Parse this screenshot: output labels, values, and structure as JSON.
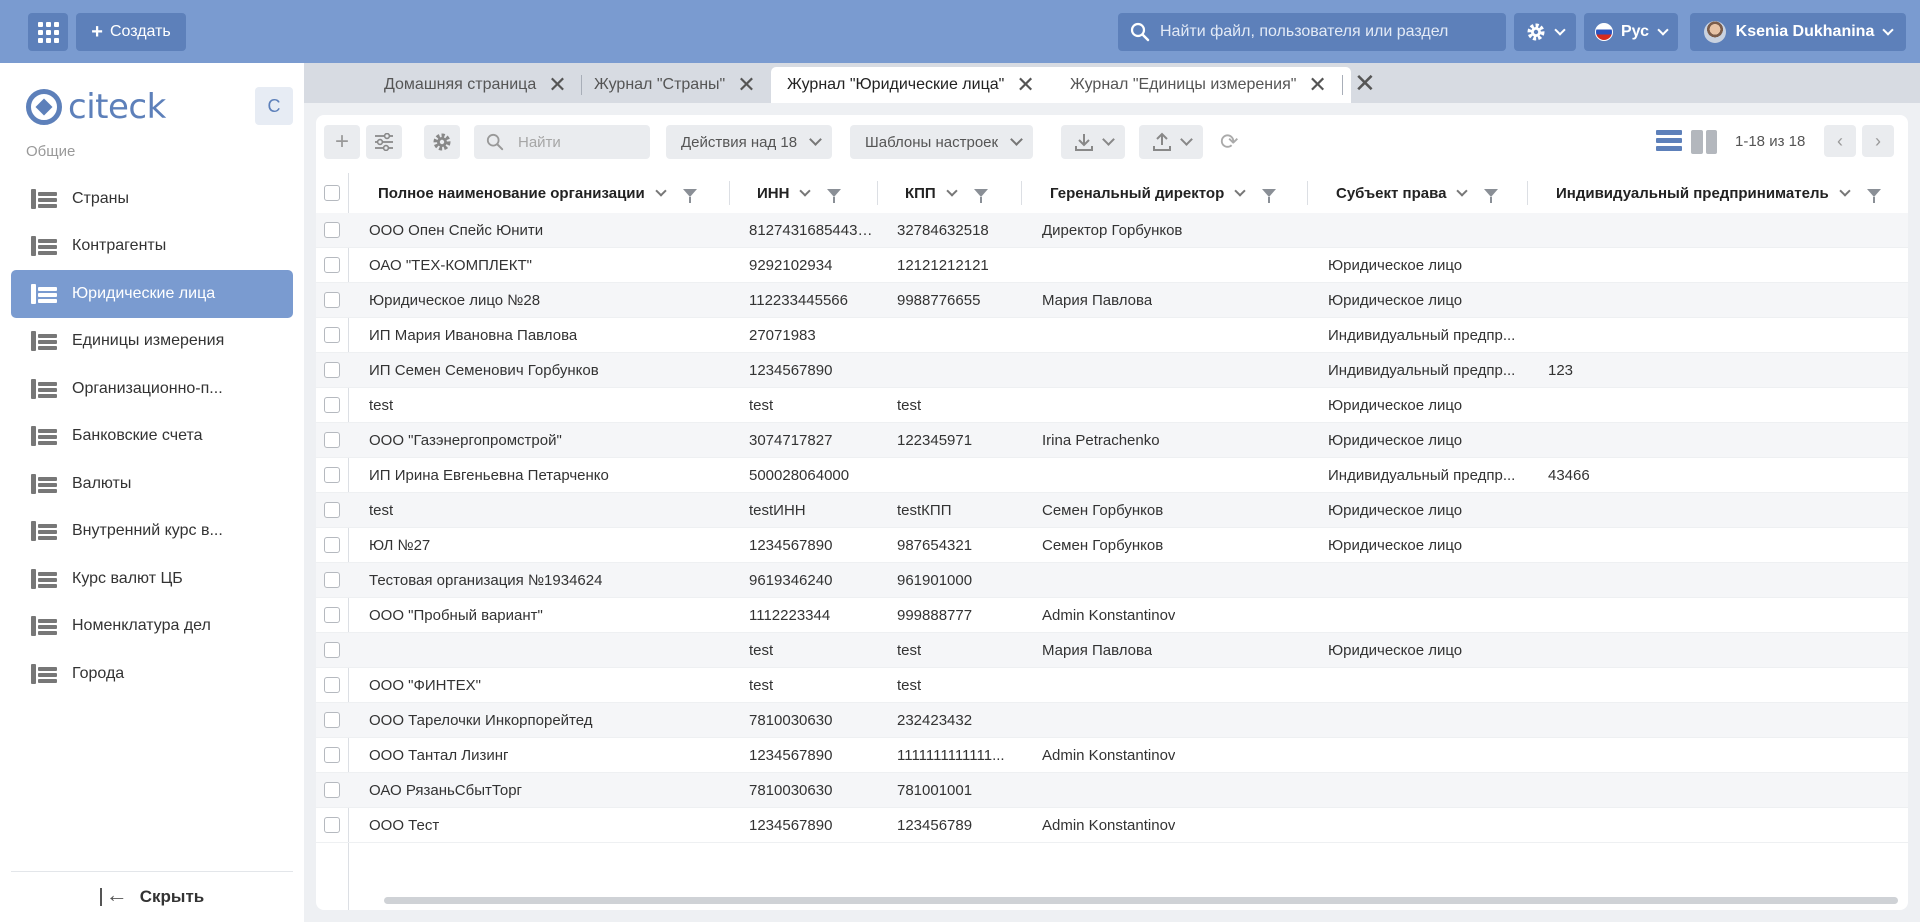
{
  "header": {
    "create_label": "Создать",
    "search_placeholder": "Найти файл, пользователя или раздел",
    "language": "Рус",
    "user_name": "Ksenia Dukhanina"
  },
  "sidebar": {
    "logo_text": "citeck",
    "collapse_letter": "C",
    "section_title": "Общие",
    "items": [
      {
        "label": "Страны"
      },
      {
        "label": "Контрагенты"
      },
      {
        "label": "Юридические лица"
      },
      {
        "label": "Единицы измерения"
      },
      {
        "label": "Организационно-п..."
      },
      {
        "label": "Банковские счета"
      },
      {
        "label": "Валюты"
      },
      {
        "label": "Внутренний курс в..."
      },
      {
        "label": "Курс валют ЦБ"
      },
      {
        "label": "Номенклатура дел"
      },
      {
        "label": "Города"
      }
    ],
    "active_index": 2,
    "hide_label": "Скрыть"
  },
  "tabs": [
    {
      "label": "Домашняя страница",
      "active": false
    },
    {
      "label": "Журнал \"Страны\"",
      "active": false
    },
    {
      "label": "Журнал \"Юридические лица\"",
      "active": true
    },
    {
      "label": "Журнал \"Единицы измерения\"",
      "active": false
    }
  ],
  "toolbar": {
    "search_placeholder": "Найти",
    "actions_label": "Действия над 18",
    "templates_label": "Шаблоны настроек",
    "pager_text": "1-18 из 18"
  },
  "table": {
    "columns": [
      "Полное наименование организации",
      "ИНН",
      "КПП",
      "Геренальный директор",
      "Субъект права",
      "Индивидуальный предприниматель"
    ],
    "rows": [
      [
        "ООО Опен Спейс Юнити",
        "81274316854432...",
        "32784632518",
        "Директор Горбунков",
        "",
        ""
      ],
      [
        "ОАО \"ТЕХ-КОМПЛЕКТ\"",
        "9292102934",
        "12121212121",
        "",
        "Юридическое лицо",
        ""
      ],
      [
        "Юридическое лицо №28",
        "112233445566",
        "9988776655",
        "Мария Павлова",
        "Юридическое лицо",
        ""
      ],
      [
        "ИП Мария Ивановна Павлова",
        "27071983",
        "",
        "",
        "Индивидуальный предпр...",
        ""
      ],
      [
        "ИП Семен Семенович Горбунков",
        "1234567890",
        "",
        "",
        "Индивидуальный предпр...",
        "123"
      ],
      [
        "test",
        "test",
        "test",
        "",
        "Юридическое лицо",
        ""
      ],
      [
        "ООО \"Газэнергопромстрой\"",
        "3074717827",
        "122345971",
        "Irina Petrachenko",
        "Юридическое лицо",
        ""
      ],
      [
        "ИП Ирина Евгеньевна Петарченко",
        "500028064000",
        "",
        "",
        "Индивидуальный предпр...",
        "43466"
      ],
      [
        "test",
        "testИНН",
        "testКПП",
        "Семен Горбунков",
        "Юридическое лицо",
        ""
      ],
      [
        "ЮЛ №27",
        "1234567890",
        "987654321",
        "Семен Горбунков",
        "Юридическое лицо",
        ""
      ],
      [
        "Тестовая организация №1934624",
        "9619346240",
        "961901000",
        "",
        "",
        ""
      ],
      [
        "ООО \"Пробный вариант\"",
        "1112223344",
        "999888777",
        "Admin Konstantinov",
        "",
        ""
      ],
      [
        "",
        "test",
        "test",
        "Мария Павлова",
        "Юридическое лицо",
        ""
      ],
      [
        "ООО \"ФИНТЕХ\"",
        "test",
        "test",
        "",
        "",
        ""
      ],
      [
        "ООО Тарелочки Инкорпорейтед",
        "7810030630",
        "232423432",
        "",
        "",
        ""
      ],
      [
        "ООО Тантал Лизинг",
        "1234567890",
        "1111111111111...",
        "Admin Konstantinov",
        "",
        ""
      ],
      [
        "ОАО РязаньСбытТорг",
        "7810030630",
        "781001001",
        "",
        "",
        ""
      ],
      [
        "ООО Тест",
        "1234567890",
        "123456789",
        "Admin Konstantinov",
        "",
        ""
      ]
    ]
  }
}
